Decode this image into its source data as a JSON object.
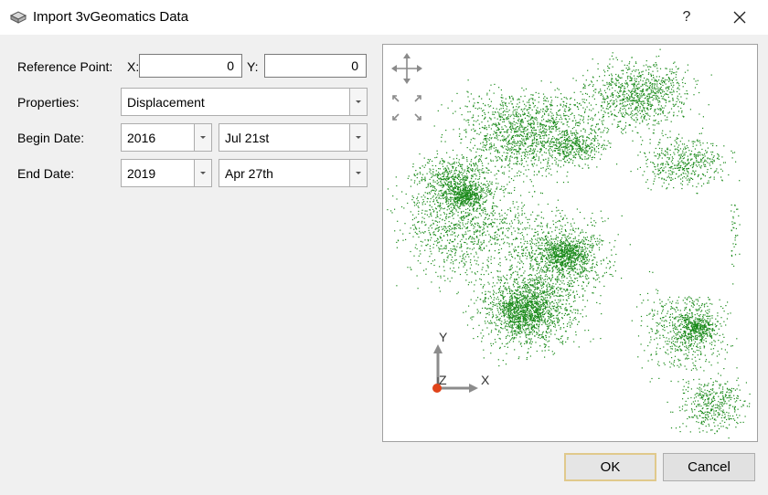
{
  "window": {
    "title": "Import 3vGeomatics Data",
    "help_label": "?"
  },
  "form": {
    "ref_label": "Reference Point:",
    "x_label": "X:",
    "x_value": "0",
    "y_label": "Y:",
    "y_value": "0",
    "properties_label": "Properties:",
    "properties_value": "Displacement",
    "begin_label": "Begin Date:",
    "begin_year": "2016",
    "begin_day": "Jul 21st",
    "end_label": "End Date:",
    "end_year": "2019",
    "end_day": "Apr 27th"
  },
  "viewport": {
    "point_color": "#1a8a1a",
    "axis_y": "Y",
    "axis_z": "Z",
    "axis_x": "X",
    "origin_color": "#e0441a",
    "icons": [
      "move-icon",
      "fit-view-icon"
    ]
  },
  "buttons": {
    "ok": "OK",
    "cancel": "Cancel"
  }
}
